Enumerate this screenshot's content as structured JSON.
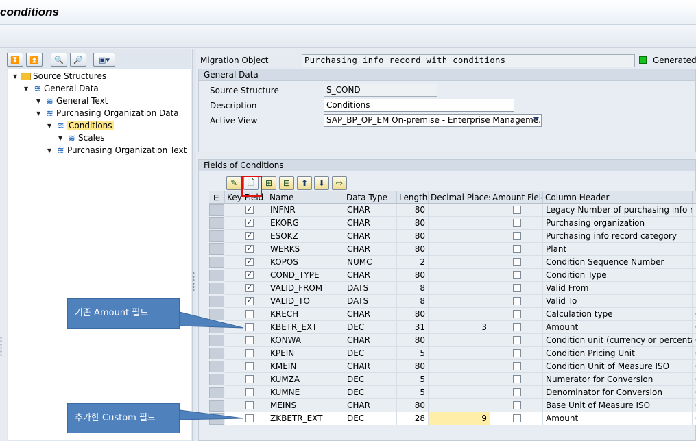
{
  "window": {
    "title": "conditions"
  },
  "tree": {
    "nodes": [
      {
        "label": "Source Structures",
        "icon": "folder-icon",
        "level": 0,
        "expanded": true
      },
      {
        "label": "General Data",
        "icon": "structure-icon",
        "level": 1,
        "expanded": true
      },
      {
        "label": "General Text",
        "icon": "structure-icon",
        "level": 2,
        "expanded": true
      },
      {
        "label": "Purchasing Organization Data",
        "icon": "structure-icon",
        "level": 2,
        "expanded": true
      },
      {
        "label": "Conditions",
        "icon": "structure-icon",
        "level": 3,
        "expanded": true,
        "selected": true
      },
      {
        "label": "Scales",
        "icon": "structure-icon",
        "level": 4,
        "expanded": true
      },
      {
        "label": "Purchasing Organization Text",
        "icon": "structure-icon",
        "level": 3,
        "expanded": true
      }
    ]
  },
  "header": {
    "migration_object_label": "Migration Object",
    "migration_object_value": "Purchasing info record with conditions",
    "status_label": "Generated",
    "status_color": "#18c21a"
  },
  "general_data": {
    "title": "General Data",
    "source_structure_label": "Source Structure",
    "source_structure_value": "S_COND",
    "description_label": "Description",
    "description_value": "Conditions",
    "active_view_label": "Active View",
    "active_view_value": "SAP_BP_OP_EM On-premise - Enterprise Manageme..."
  },
  "fields": {
    "title": "Fields of Conditions",
    "columns": [
      "Key Field",
      "Name",
      "Data Type",
      "Length",
      "Decimal Places",
      "Amount Field",
      "Column Header"
    ],
    "rows": [
      {
        "key": true,
        "name": "INFNR",
        "type": "CHAR",
        "length": "80",
        "decimals": "",
        "amount": false,
        "header": "Legacy Number of purchasing info re...",
        "extra": "H"
      },
      {
        "key": true,
        "name": "EKORG",
        "type": "CHAR",
        "length": "80",
        "decimals": "",
        "amount": false,
        "header": "Purchasing organization",
        "extra": "H"
      },
      {
        "key": true,
        "name": "ESOKZ",
        "type": "CHAR",
        "length": "80",
        "decimals": "",
        "amount": false,
        "header": "Purchasing info record category",
        "extra": "H"
      },
      {
        "key": true,
        "name": "WERKS",
        "type": "CHAR",
        "length": "80",
        "decimals": "",
        "amount": false,
        "header": "Plant",
        "extra": "H"
      },
      {
        "key": true,
        "name": "KOPOS",
        "type": "NUMC",
        "length": "2",
        "decimals": "",
        "amount": false,
        "header": "Condition Sequence Number",
        "extra": "H"
      },
      {
        "key": true,
        "name": "COND_TYPE",
        "type": "CHAR",
        "length": "80",
        "decimals": "",
        "amount": false,
        "header": "Condition Type",
        "extra": "H"
      },
      {
        "key": true,
        "name": "VALID_FROM",
        "type": "DATS",
        "length": "8",
        "decimals": "",
        "amount": false,
        "header": "Valid From",
        "extra": "H"
      },
      {
        "key": true,
        "name": "VALID_TO",
        "type": "DATS",
        "length": "8",
        "decimals": "",
        "amount": false,
        "header": "Valid To",
        "extra": "H"
      },
      {
        "key": false,
        "name": "KRECH",
        "type": "CHAR",
        "length": "80",
        "decimals": "",
        "amount": false,
        "header": "Calculation type",
        "extra": "C"
      },
      {
        "key": false,
        "name": "KBETR_EXT",
        "type": "DEC",
        "length": "31",
        "decimals": "3",
        "amount": false,
        "header": "Amount",
        "extra": "C"
      },
      {
        "key": false,
        "name": "KONWA",
        "type": "CHAR",
        "length": "80",
        "decimals": "",
        "amount": false,
        "header": "Condition unit (currency or percenta...",
        "extra": "C"
      },
      {
        "key": false,
        "name": "KPEIN",
        "type": "DEC",
        "length": "5",
        "decimals": "",
        "amount": false,
        "header": "Condition Pricing Unit",
        "extra": "C"
      },
      {
        "key": false,
        "name": "KMEIN",
        "type": "CHAR",
        "length": "80",
        "decimals": "",
        "amount": false,
        "header": "Condition Unit of Measure ISO",
        "extra": "C"
      },
      {
        "key": false,
        "name": "KUMZA",
        "type": "DEC",
        "length": "5",
        "decimals": "",
        "amount": false,
        "header": "Numerator for Conversion",
        "extra": "C"
      },
      {
        "key": false,
        "name": "KUMNE",
        "type": "DEC",
        "length": "5",
        "decimals": "",
        "amount": false,
        "header": "Denominator for Conversion",
        "extra": "C"
      },
      {
        "key": false,
        "name": "MEINS",
        "type": "CHAR",
        "length": "80",
        "decimals": "",
        "amount": false,
        "header": "Base Unit of Measure ISO",
        "extra": "C"
      },
      {
        "key": false,
        "name": "ZKBETR_EXT",
        "type": "DEC",
        "length": "28",
        "decimals": "9",
        "amount": false,
        "header": "Amount",
        "extra": "C",
        "editable": true
      }
    ]
  },
  "callouts": {
    "existing": "기존 Amount 필드",
    "added": "추가한 Custom 필드"
  },
  "colors": {
    "callout": "#4f81bd",
    "highlight_box": "#e01010",
    "selected_tree": "#ffe88a"
  }
}
